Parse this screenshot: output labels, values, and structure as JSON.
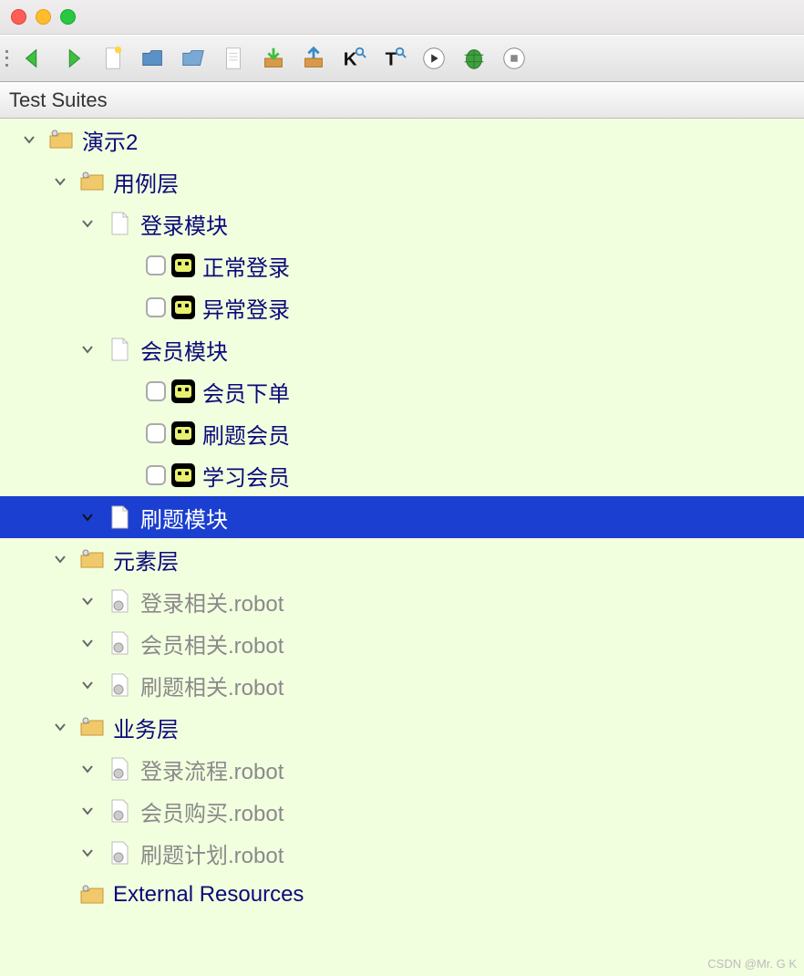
{
  "panel_title": "Test Suites",
  "toolbar": {
    "back": "back",
    "forward": "forward",
    "new_file": "new_file",
    "open": "open",
    "open_folder": "open_folder",
    "paste": "paste",
    "save": "save",
    "save_as": "save_as",
    "keyword": "K",
    "text_search": "T",
    "run": "run",
    "debug": "debug",
    "stop": "stop"
  },
  "tree": {
    "root": "演示2",
    "layer1": "用例层",
    "mod_login": "登录模块",
    "tc_login_ok": "正常登录",
    "tc_login_err": "异常登录",
    "mod_member": "会员模块",
    "tc_member_order": "会员下单",
    "tc_member_brush": "刷题会员",
    "tc_member_study": "学习会员",
    "mod_brush": "刷题模块",
    "layer2": "元素层",
    "res_login": "登录相关.robot",
    "res_member": "会员相关.robot",
    "res_brush": "刷题相关.robot",
    "layer3": "业务层",
    "flow_login": "登录流程.robot",
    "flow_member": "会员购买.robot",
    "flow_brush": "刷题计划.robot",
    "external": "External Resources"
  },
  "watermark": "CSDN @Mr. G K"
}
